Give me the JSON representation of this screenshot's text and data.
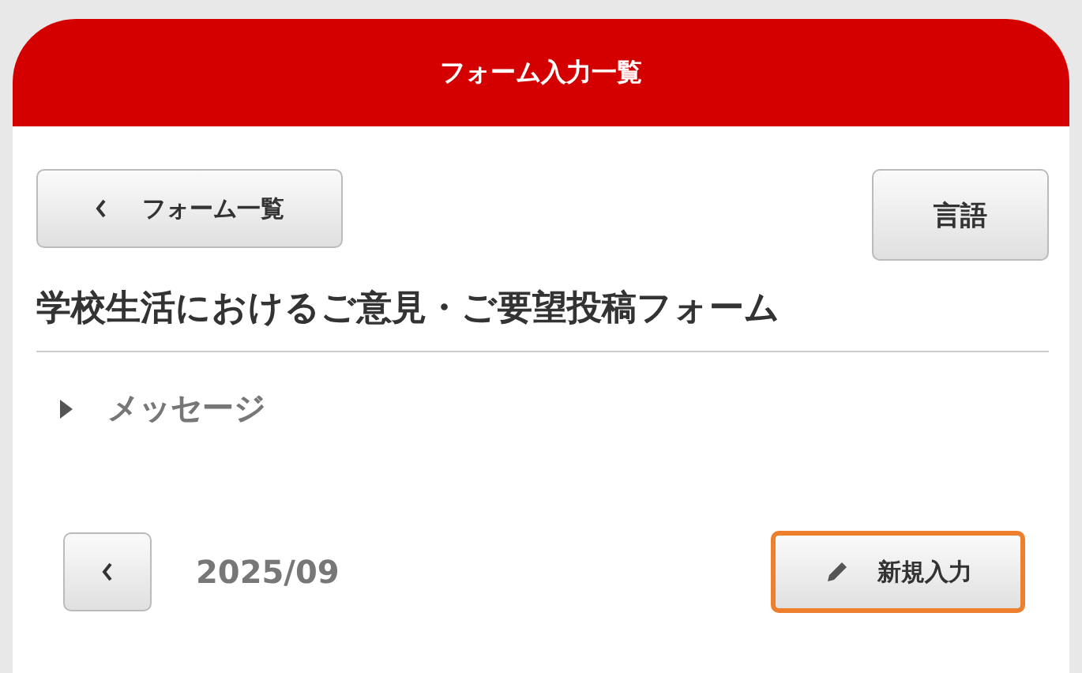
{
  "header": {
    "title": "フォーム入力一覧"
  },
  "back_button": {
    "label": "フォーム一覧"
  },
  "language_button": {
    "label": "言語"
  },
  "form_title": "学校生活におけるご意見・ご要望投稿フォーム",
  "message_section": {
    "label": "メッセージ",
    "expanded": false
  },
  "month_nav": {
    "month": "2025/09"
  },
  "new_entry_button": {
    "label": "新規入力",
    "focused": true
  }
}
